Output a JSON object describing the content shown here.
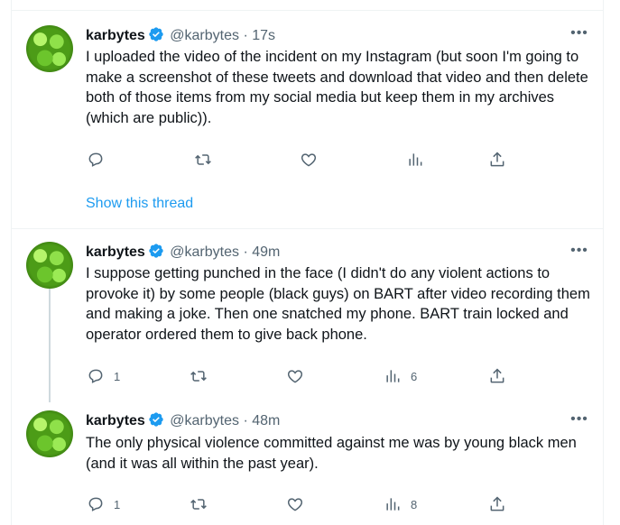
{
  "tweets": [
    {
      "name": "karbytes",
      "handle": "@karbytes",
      "separator": "·",
      "time": "17s",
      "more": "•••",
      "text": "I uploaded the video of the incident on my Instagram (but soon I'm going to make a screenshot of these tweets and download that video and then delete both of those items from my social media but keep them in my archives (which are public)).",
      "replies": "",
      "views": ""
    },
    {
      "name": "karbytes",
      "handle": "@karbytes",
      "separator": "·",
      "time": "49m",
      "more": "•••",
      "text": "I suppose getting punched in the face (I didn't do any violent actions to provoke it) by some people (black guys) on BART after video recording them and making a joke. Then one snatched my phone. BART train locked and operator ordered them to give back phone.",
      "replies": "1",
      "views": "6"
    },
    {
      "name": "karbytes",
      "handle": "@karbytes",
      "separator": "·",
      "time": "48m",
      "more": "•••",
      "text": "The only physical violence committed against me was by young black men (and it was all within the past year).",
      "replies": "1",
      "views": "8"
    }
  ],
  "show_thread": "Show this thread",
  "colors": {
    "accent": "#1d9bf0",
    "muted": "#536471",
    "text": "#0f1419"
  },
  "icons": [
    "reply-icon",
    "retweet-icon",
    "like-icon",
    "views-icon",
    "share-icon",
    "verified-badge-icon",
    "more-icon"
  ]
}
